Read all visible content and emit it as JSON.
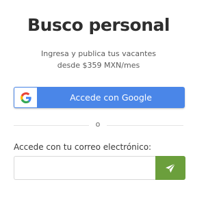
{
  "header": {
    "title": "Busco personal",
    "subtitle_line1": "Ingresa y publica tus vacantes",
    "subtitle_line2": "desde $359 MXN/mes"
  },
  "google_login": {
    "label": "Accede con Google",
    "icon": "google-g-icon",
    "button_color": "#4a86e8"
  },
  "divider": {
    "or_text": "o"
  },
  "email_login": {
    "label": "Accede con tu correo electrónico:",
    "input_value": "",
    "input_placeholder": "",
    "submit_icon": "paper-plane-icon",
    "submit_color": "#6b9f3c"
  }
}
